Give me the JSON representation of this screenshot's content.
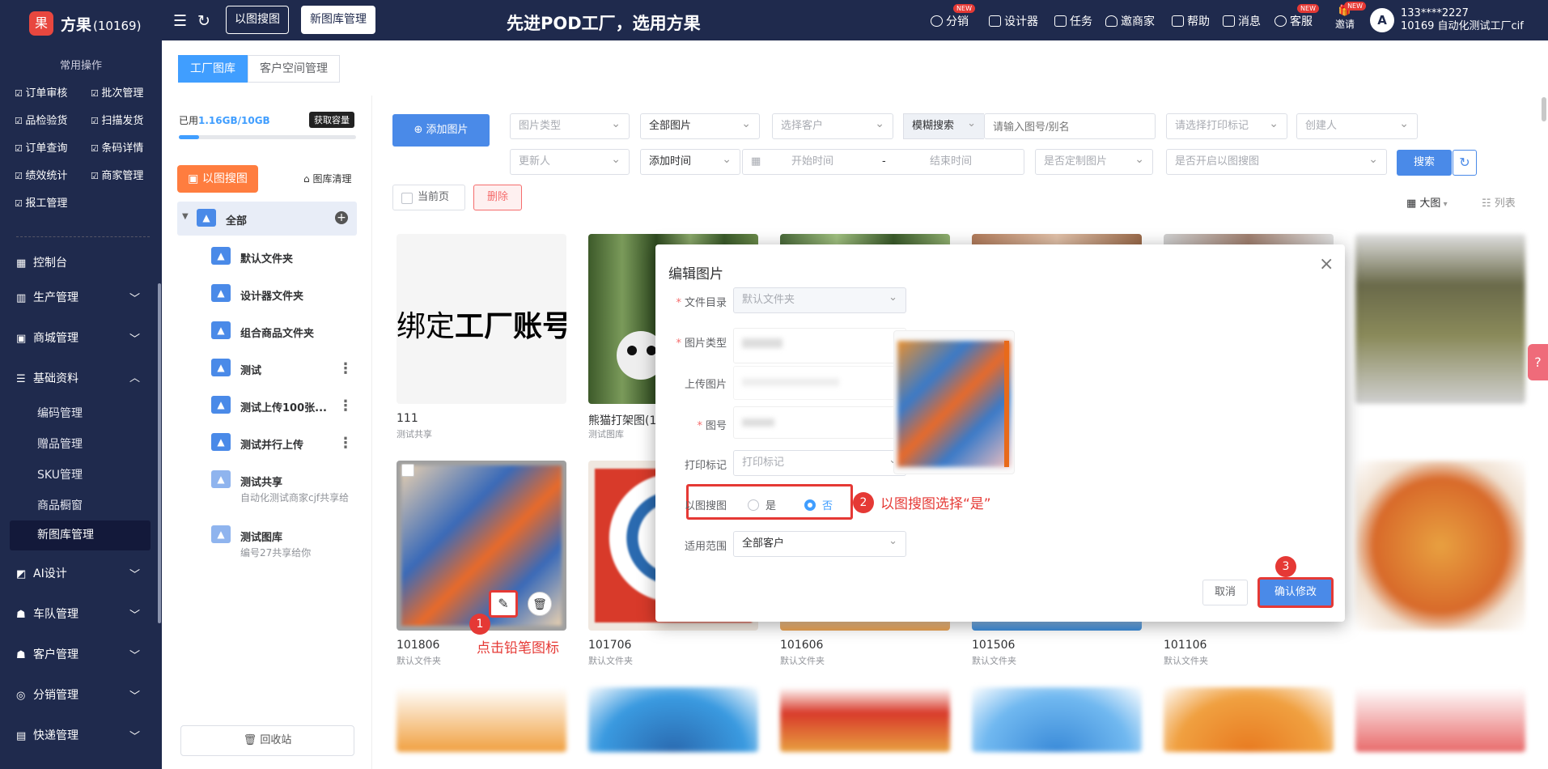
{
  "header": {
    "logo_char": "果",
    "brand": "方果",
    "brand_id": "(10169)",
    "btn_image_search": "以图搜图",
    "btn_new_library": "新图库管理",
    "slogan": "先进POD工厂，选用方果",
    "nav": [
      "分销",
      "设计器",
      "任务",
      "邀商家",
      "帮助",
      "消息",
      "客服",
      "邀请"
    ],
    "new_badge": "NEW",
    "user_line1": "133****2227",
    "user_line2": "10169 自动化测试工厂cif",
    "avatar_letter": "A"
  },
  "sidebar": {
    "quick_title": "常用操作",
    "quick": [
      "订单审核",
      "批次管理",
      "品检验货",
      "扫描发货",
      "订单查询",
      "条码详情",
      "绩效统计",
      "商家管理",
      "报工管理"
    ],
    "menu": [
      "控制台",
      "生产管理",
      "商城管理",
      "基础资料",
      "AI设计",
      "车队管理",
      "客户管理",
      "分销管理",
      "快递管理"
    ],
    "submenu": [
      "编码管理",
      "赠品管理",
      "SKU管理",
      "商品橱窗",
      "新图库管理"
    ]
  },
  "tabs": [
    "工厂图库",
    "客户空间管理"
  ],
  "library": {
    "used_prefix": "已用",
    "used_value": "1.16GB/10GB",
    "usage_fraction": 0.116,
    "get_capacity": "获取容量",
    "image_search_btn": "以图搜图",
    "clean_btn": "图库清理",
    "folders": [
      {
        "name": "全部",
        "sub": ""
      },
      {
        "name": "默认文件夹",
        "sub": ""
      },
      {
        "name": "设计器文件夹",
        "sub": ""
      },
      {
        "name": "组合商品文件夹",
        "sub": ""
      },
      {
        "name": "测试",
        "sub": ""
      },
      {
        "name": "测试上传100张...",
        "sub": ""
      },
      {
        "name": "测试并行上传",
        "sub": ""
      },
      {
        "name": "测试共享",
        "sub": "自动化测试商家cjf共享给"
      },
      {
        "name": "测试图库",
        "sub": "编号27共享给你"
      }
    ],
    "recycle": "回收站"
  },
  "toolbar": {
    "add_image": "添加图片",
    "image_type": "图片类型",
    "all_images": "全部图片",
    "choose_customer": "选择客户",
    "fuzzy": "模糊搜索",
    "search_placeholder": "请输入图号/别名",
    "print_mark": "请选择打印标记",
    "creator": "创建人",
    "updater": "更新人",
    "add_time": "添加时间",
    "start_time": "开始时间",
    "dash": "-",
    "end_time": "结束时间",
    "custom_image": "是否定制图片",
    "enable_search": "是否开启以图搜图",
    "search": "搜索",
    "current_page": "当前页",
    "delete": "删除",
    "view_large": "大图",
    "view_list": "列表"
  },
  "cards": [
    {
      "title": "111",
      "sub": "测试共享",
      "bind_text_1": "绑定",
      "bind_text_2": "工厂账号"
    },
    {
      "title": "熊猫打架图(1",
      "sub": "测试图库"
    },
    {
      "title": "101806",
      "sub": "默认文件夹"
    },
    {
      "title": "101706",
      "sub": "默认文件夹"
    },
    {
      "title": "101606",
      "sub": "默认文件夹"
    },
    {
      "title": "101506",
      "sub": "默认文件夹"
    },
    {
      "title": "101106",
      "sub": "默认文件夹"
    }
  ],
  "dialog": {
    "title": "编辑图片",
    "close": "×",
    "labels": {
      "dir": "文件目录",
      "type": "图片类型",
      "upload": "上传图片",
      "number": "图号",
      "print": "打印标记",
      "search": "以图搜图",
      "scope": "适用范围"
    },
    "dir_value": "默认文件夹",
    "print_placeholder": "打印标记",
    "radio_yes": "是",
    "radio_no": "否",
    "scope_value": "全部客户",
    "cancel": "取消",
    "confirm": "确认修改"
  },
  "annotations": {
    "step1": "1",
    "step1_text": "点击铅笔图标",
    "step2": "2",
    "step2_text": "以图搜图选择“是”",
    "step3": "3"
  }
}
